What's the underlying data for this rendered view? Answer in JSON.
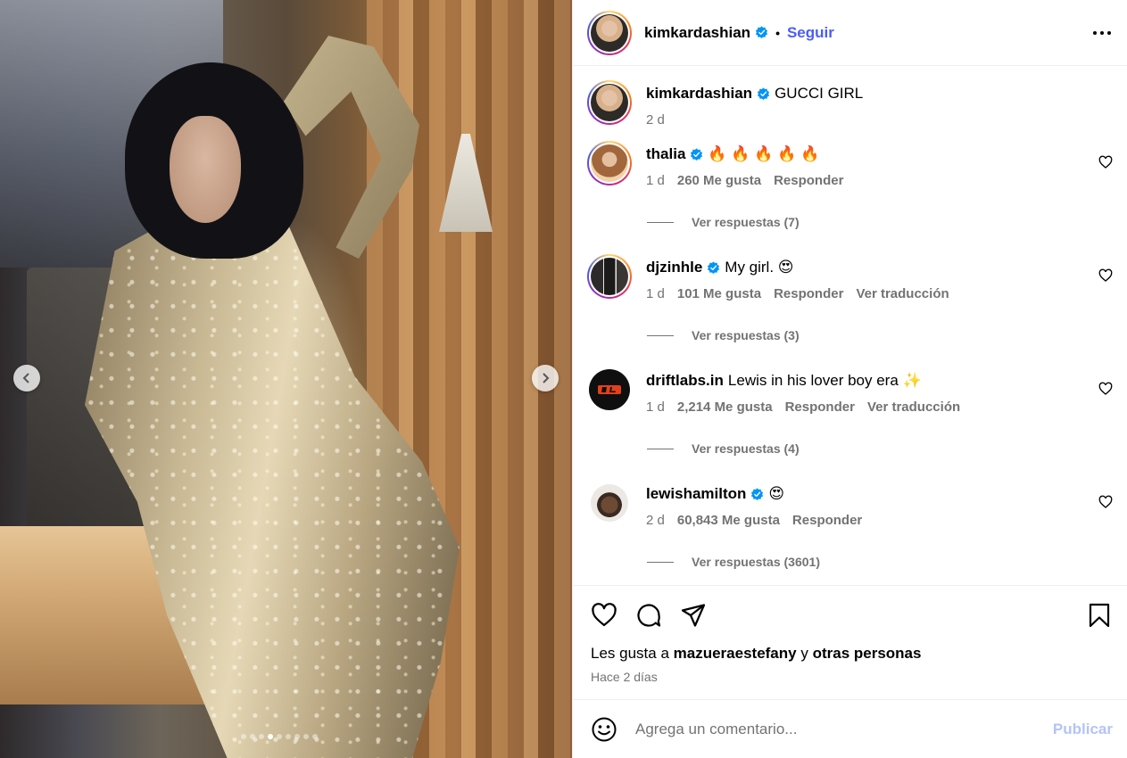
{
  "media": {
    "slide_count": 9,
    "active_slide": 3,
    "prev_icon": "chevron-left-icon",
    "next_icon": "chevron-right-icon"
  },
  "header": {
    "username": "kimkardashian",
    "separator": "•",
    "follow_label": "Seguir",
    "more_icon": "more-horizontal-icon"
  },
  "caption": {
    "username": "kimkardashian",
    "text": "GUCCI GIRL",
    "time": "2 d"
  },
  "comments": [
    {
      "username": "thalia",
      "text": "🔥 🔥 🔥 🔥 🔥",
      "time": "1 d",
      "likes": "260 Me gusta",
      "reply_label": "Responder",
      "translate_label": "",
      "view_replies": "Ver respuestas (7)"
    },
    {
      "username": "djzinhle",
      "text": "My girl. 😍",
      "time": "1 d",
      "likes": "101 Me gusta",
      "reply_label": "Responder",
      "translate_label": "Ver traducción",
      "view_replies": "Ver respuestas (3)"
    },
    {
      "username": "driftlabs.in",
      "text": "Lewis in his lover boy era ✨",
      "time": "1 d",
      "likes": "2,214 Me gusta",
      "reply_label": "Responder",
      "translate_label": "Ver traducción",
      "view_replies": "Ver respuestas (4)"
    },
    {
      "username": "lewishamilton",
      "text": "😍",
      "time": "2 d",
      "likes": "60,843 Me gusta",
      "reply_label": "Responder",
      "translate_label": "",
      "view_replies": "Ver respuestas (3601)"
    }
  ],
  "actions": {
    "icons": [
      "heart-icon",
      "comment-icon",
      "share-icon",
      "bookmark-icon"
    ],
    "likes_prefix": "Les gusta a",
    "likes_user": "mazueraestefany",
    "likes_joiner": "y",
    "likes_others": "otras personas",
    "posted": "Hace 2 días"
  },
  "add_comment": {
    "placeholder": "Agrega un comentario...",
    "publish_label": "Publicar",
    "emoji_icon": "emoji-icon"
  },
  "colors": {
    "verified": "#0095f6",
    "follow": "#4a5df9",
    "publish_disabled": "#b3c4f7",
    "muted": "#737373"
  }
}
